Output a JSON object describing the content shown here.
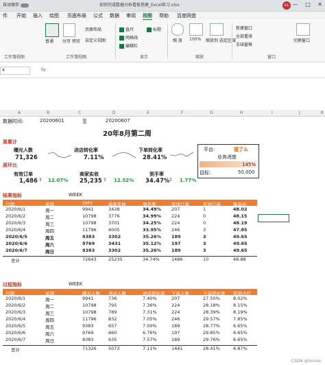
{
  "titlebar": {
    "autosave": "自动保存",
    "title": "如何完成数据分析看板搭建_Excel练习.xlsx",
    "avatar": "GL",
    "min": "—",
    "max": "□",
    "close": "✕"
  },
  "menu": {
    "items": [
      "件",
      "开始",
      "插入",
      "绘图",
      "页面布局",
      "公式",
      "数据",
      "审阅",
      "视图",
      "帮助",
      "百度网盘"
    ],
    "active_index": 8
  },
  "ribbon": {
    "normal": "普通",
    "page_break": "分页\n预览",
    "page_layout": "页面布局",
    "custom_view": "自定义视图",
    "workbook_view_group": "工作簿视图",
    "work_view_group": "工作簿视图",
    "ruler": "直尺",
    "gridlines": "网格线",
    "formula_bar": "编辑栏",
    "headings": "标题",
    "show_group": "显示",
    "zoom": "缩\n放",
    "zoom100": "100%",
    "zoom_sel": "缩放到\n选定区域",
    "zoom_group": "缩放",
    "new_window": "新建窗口",
    "arrange_all": "全部重排",
    "freeze": "冻结窗格",
    "window_group": "窗口",
    "switch_window": "切换窗口"
  },
  "formula": {
    "namebox": "4",
    "fx": "fx"
  },
  "columns": [
    "A",
    "B",
    "C",
    "D",
    "E",
    "F",
    "G",
    "H",
    "I",
    "J",
    "K"
  ],
  "sheet": {
    "date_label": "数据时间:",
    "date_from": "20200601",
    "to": "至",
    "date_to": "20200607",
    "title": "20年8月第二周",
    "cumulative": "周累计",
    "wow": "周环比",
    "kpis": [
      {
        "label": "曝光人数",
        "value": "71,326"
      },
      {
        "label": "进店转化率",
        "value": "7.11%"
      },
      {
        "label": "下单转化率",
        "value": "28.41%"
      }
    ],
    "kpis2": [
      {
        "label": "有效订单",
        "value": "1,486",
        "pct": "12.07%"
      },
      {
        "label": "商家实收",
        "value": "25,235",
        "pct": "12.52%"
      },
      {
        "label": "到手率",
        "value": "34.47%",
        "pct": "1.77%"
      }
    ],
    "platform_label": "平台:",
    "platform": "饿了么",
    "progress_label": "业务进度",
    "progress_value": "145%",
    "progress_fraction": 1.0,
    "target_label": "目标:",
    "target": "50,000",
    "t1": {
      "section": "结果指标",
      "week": "WEEK",
      "headers": [
        "日期",
        "星期",
        "GMV",
        "商家实收",
        "到手率",
        "有效订单",
        "无效订单",
        "客单价"
      ],
      "rows": [
        {
          "cells": [
            "2020/6/1",
            "周一",
            "9941",
            "3428",
            "34.49%",
            "207",
            "1",
            "48.02"
          ],
          "bold": false
        },
        {
          "cells": [
            "2020/6/2",
            "周二",
            "10798",
            "3776",
            "34.99%",
            "224",
            "0",
            "48.15"
          ],
          "bold": false
        },
        {
          "cells": [
            "2020/6/3",
            "周三",
            "10798",
            "3701",
            "34.25%",
            "224",
            "0",
            "48.19"
          ],
          "bold": false
        },
        {
          "cells": [
            "2020/6/4",
            "周四",
            "11796",
            "4005",
            "33.95%",
            "246",
            "3",
            "47.85"
          ],
          "bold": false
        },
        {
          "cells": [
            "2020/6/5",
            "周五",
            "9383",
            "3302",
            "35.26%",
            "189",
            "3",
            "49.65"
          ],
          "bold": true
        },
        {
          "cells": [
            "2020/6/6",
            "周六",
            "9769",
            "3431",
            "35.12%",
            "197",
            "3",
            "49.65"
          ],
          "bold": true
        },
        {
          "cells": [
            "2020/6/7",
            "周日",
            "9383",
            "3302",
            "35.26%",
            "189",
            "3",
            "49.65"
          ],
          "bold": true
        }
      ],
      "total": [
        "总计",
        "",
        "72643",
        "25235",
        "34.74%",
        "1486",
        "10",
        "48.88"
      ]
    },
    "t2": {
      "section": "过程指标",
      "week": "WEEK",
      "headers": [
        "日期",
        "星期",
        "曝光人数",
        "进店人数",
        "进店转化率",
        "下单人数",
        "下单转化率",
        "营销占比"
      ],
      "rows": [
        [
          "2020/6/1",
          "周一",
          "9941",
          "736",
          "7.40%",
          "207",
          "27.50%",
          "8.02%"
        ],
        [
          "2020/6/2",
          "周二",
          "10798",
          "795",
          "7.36%",
          "224",
          "28.18%",
          "8.15%"
        ],
        [
          "2020/6/3",
          "周三",
          "10798",
          "789",
          "7.31%",
          "224",
          "28.39%",
          "8.19%"
        ],
        [
          "2020/6/4",
          "周四",
          "11796",
          "832",
          "7.05%",
          "246",
          "29.57%",
          "7.85%"
        ],
        [
          "2020/6/5",
          "周五",
          "9383",
          "657",
          "7.00%",
          "189",
          "28.77%",
          "6.65%"
        ],
        [
          "2020/6/6",
          "周六",
          "9769",
          "660",
          "6.76%",
          "197",
          "29.85%",
          "6.65%"
        ],
        [
          "2020/6/7",
          "周日",
          "8383",
          "635",
          "7.57%",
          "189",
          "29.76%",
          "6.65%"
        ]
      ],
      "total": [
        "总计",
        "",
        "71326",
        "5073",
        "7.11%",
        "1441",
        "28.41%",
        "6.87%"
      ]
    }
  },
  "status": {
    "watermark": "CSDN @lonine"
  },
  "colors": {
    "accent": "#217346",
    "orange": "#ed7d31",
    "red": "#c0392b",
    "green": "#2e8b3a"
  }
}
